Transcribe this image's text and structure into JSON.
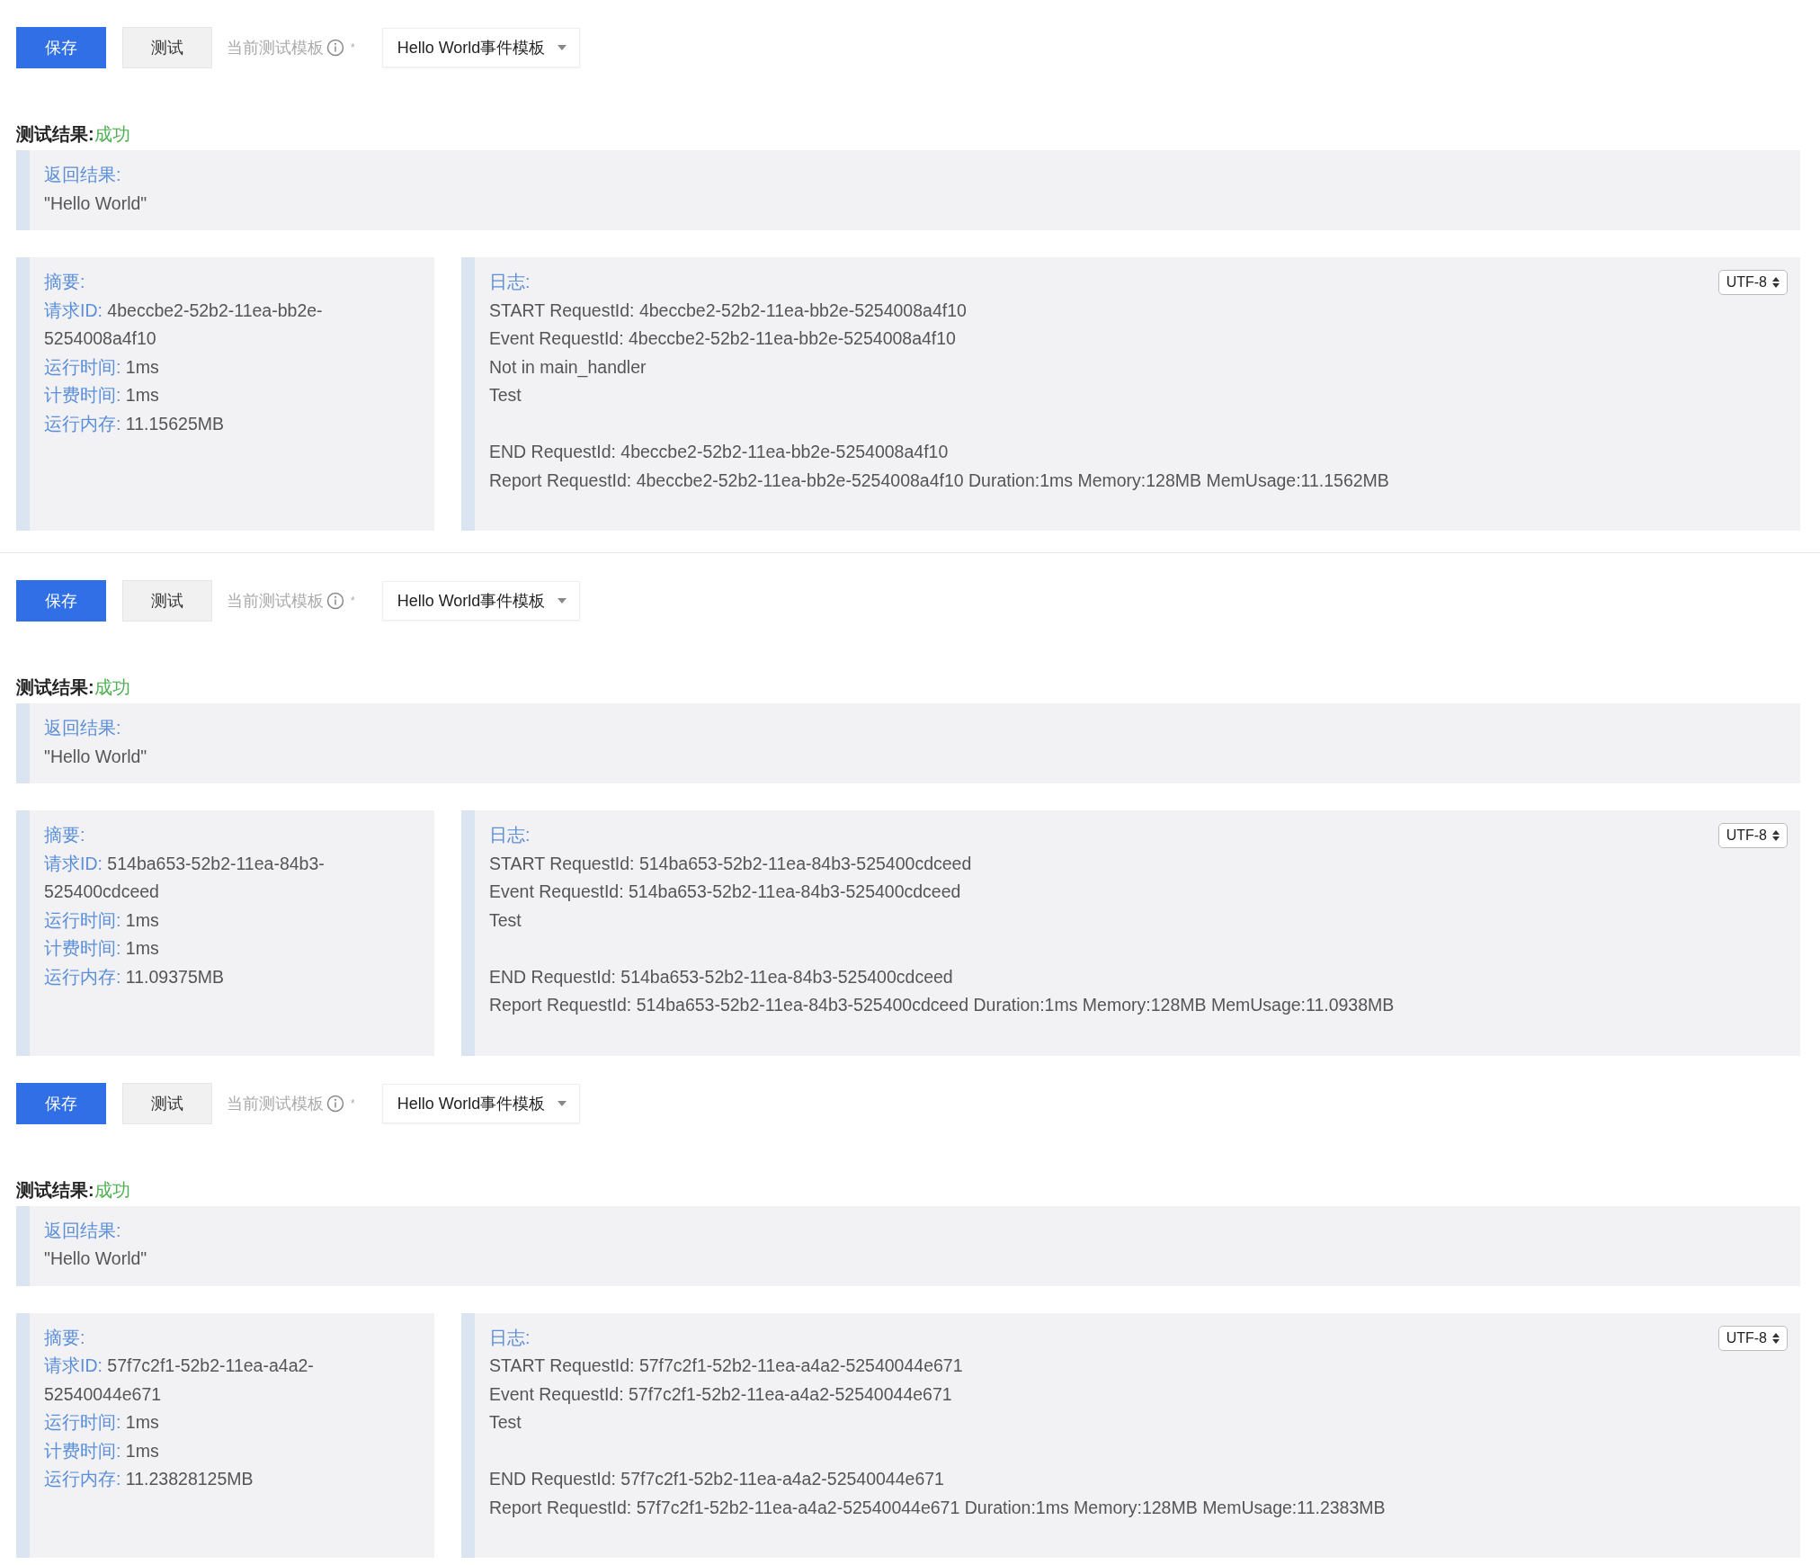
{
  "panels": [
    {
      "toolbar": {
        "save": "保存",
        "test": "测试",
        "template_label": "当前测试模板",
        "required_mark": "*",
        "template": "Hello World事件模板"
      },
      "result": {
        "title": "测试结果:",
        "status": "成功"
      },
      "returned": {
        "label": "返回结果:",
        "value": "\"Hello World\""
      },
      "summary": {
        "label": "摘要:",
        "fields": [
          {
            "label": "请求ID:",
            "value": "4beccbe2-52b2-11ea-bb2e-5254008a4f10"
          },
          {
            "label": "运行时间:",
            "value": "1ms"
          },
          {
            "label": "计费时间:",
            "value": "1ms"
          },
          {
            "label": "运行内存:",
            "value": "11.15625MB"
          }
        ]
      },
      "log": {
        "label": "日志:",
        "encoding": "UTF-8",
        "groups": [
          [
            "START RequestId: 4beccbe2-52b2-11ea-bb2e-5254008a4f10",
            "Event RequestId: 4beccbe2-52b2-11ea-bb2e-5254008a4f10",
            "Not in main_handler",
            "Test"
          ],
          [
            "END RequestId: 4beccbe2-52b2-11ea-bb2e-5254008a4f10",
            "Report RequestId: 4beccbe2-52b2-11ea-bb2e-5254008a4f10 Duration:1ms Memory:128MB MemUsage:11.1562MB"
          ]
        ]
      },
      "divider": true
    },
    {
      "toolbar": {
        "save": "保存",
        "test": "测试",
        "template_label": "当前测试模板",
        "required_mark": "*",
        "template": "Hello World事件模板"
      },
      "result": {
        "title": "测试结果:",
        "status": "成功"
      },
      "returned": {
        "label": "返回结果:",
        "value": "\"Hello World\""
      },
      "summary": {
        "label": "摘要:",
        "fields": [
          {
            "label": "请求ID:",
            "value": "514ba653-52b2-11ea-84b3-525400cdceed"
          },
          {
            "label": "运行时间:",
            "value": "1ms"
          },
          {
            "label": "计费时间:",
            "value": "1ms"
          },
          {
            "label": "运行内存:",
            "value": "11.09375MB"
          }
        ]
      },
      "log": {
        "label": "日志:",
        "encoding": "UTF-8",
        "groups": [
          [
            "START RequestId: 514ba653-52b2-11ea-84b3-525400cdceed",
            "Event RequestId: 514ba653-52b2-11ea-84b3-525400cdceed",
            "Test"
          ],
          [
            "END RequestId: 514ba653-52b2-11ea-84b3-525400cdceed",
            "Report RequestId: 514ba653-52b2-11ea-84b3-525400cdceed Duration:1ms Memory:128MB MemUsage:11.0938MB"
          ]
        ]
      },
      "divider": false
    },
    {
      "toolbar": {
        "save": "保存",
        "test": "测试",
        "template_label": "当前测试模板",
        "required_mark": "*",
        "template": "Hello World事件模板"
      },
      "result": {
        "title": "测试结果:",
        "status": "成功"
      },
      "returned": {
        "label": "返回结果:",
        "value": "\"Hello World\""
      },
      "summary": {
        "label": "摘要:",
        "fields": [
          {
            "label": "请求ID:",
            "value": "57f7c2f1-52b2-11ea-a4a2-52540044e671"
          },
          {
            "label": "运行时间:",
            "value": "1ms"
          },
          {
            "label": "计费时间:",
            "value": "1ms"
          },
          {
            "label": "运行内存:",
            "value": "11.23828125MB"
          }
        ]
      },
      "log": {
        "label": "日志:",
        "encoding": "UTF-8",
        "groups": [
          [
            "START RequestId: 57f7c2f1-52b2-11ea-a4a2-52540044e671",
            "Event RequestId: 57f7c2f1-52b2-11ea-a4a2-52540044e671",
            "Test"
          ],
          [
            "END RequestId: 57f7c2f1-52b2-11ea-a4a2-52540044e671",
            "Report RequestId: 57f7c2f1-52b2-11ea-a4a2-52540044e671 Duration:1ms Memory:128MB MemUsage:11.2383MB"
          ]
        ]
      },
      "divider": false
    }
  ]
}
